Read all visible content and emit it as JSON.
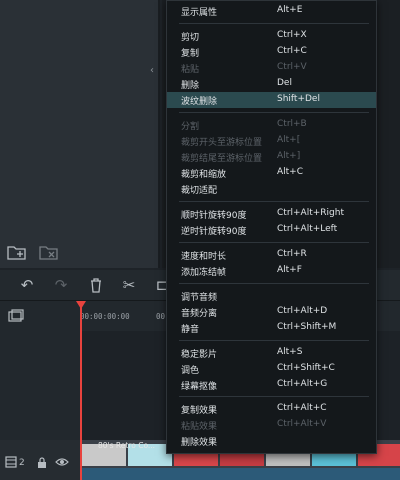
{
  "colors": {
    "accent_playhead": "#e8433e",
    "menu_highlight": "#2b4a4f",
    "menu_bg": "#14181b"
  },
  "ruler": {
    "time_start": "00:00:00:00",
    "time_next": "00"
  },
  "track": {
    "count": "2"
  },
  "clip": {
    "name": "80's Retro Co..."
  },
  "context_menu": {
    "items": [
      {
        "label": "显示属性",
        "shortcut": "Alt+E",
        "disabled": false
      },
      {
        "label": "剪切",
        "shortcut": "Ctrl+X",
        "disabled": false
      },
      {
        "label": "复制",
        "shortcut": "Ctrl+C",
        "disabled": false
      },
      {
        "label": "粘贴",
        "shortcut": "Ctrl+V",
        "disabled": true
      },
      {
        "label": "删除",
        "shortcut": "Del",
        "disabled": false
      },
      {
        "label": "波纹删除",
        "shortcut": "Shift+Del",
        "disabled": false,
        "highlighted": true
      },
      {
        "label": "分割",
        "shortcut": "Ctrl+B",
        "disabled": true
      },
      {
        "label": "裁剪开头至游标位置",
        "shortcut": "Alt+[",
        "disabled": true
      },
      {
        "label": "裁剪结尾至游标位置",
        "shortcut": "Alt+]",
        "disabled": true
      },
      {
        "label": "裁剪和缩放",
        "shortcut": "Alt+C",
        "disabled": false
      },
      {
        "label": "裁切适配",
        "shortcut": "",
        "disabled": false
      },
      {
        "label": "顺时针旋转90度",
        "shortcut": "Ctrl+Alt+Right",
        "disabled": false
      },
      {
        "label": "逆时针旋转90度",
        "shortcut": "Ctrl+Alt+Left",
        "disabled": false
      },
      {
        "label": "速度和时长",
        "shortcut": "Ctrl+R",
        "disabled": false
      },
      {
        "label": "添加冻结帧",
        "shortcut": "Alt+F",
        "disabled": false
      },
      {
        "label": "调节音频",
        "shortcut": "",
        "disabled": false
      },
      {
        "label": "音频分离",
        "shortcut": "Ctrl+Alt+D",
        "disabled": false
      },
      {
        "label": "静音",
        "shortcut": "Ctrl+Shift+M",
        "disabled": false
      },
      {
        "label": "稳定影片",
        "shortcut": "Alt+S",
        "disabled": false
      },
      {
        "label": "调色",
        "shortcut": "Ctrl+Shift+C",
        "disabled": false
      },
      {
        "label": "绿幕抠像",
        "shortcut": "Ctrl+Alt+G",
        "disabled": false
      },
      {
        "label": "复制效果",
        "shortcut": "Ctrl+Alt+C",
        "disabled": false
      },
      {
        "label": "粘贴效果",
        "shortcut": "Ctrl+Alt+V",
        "disabled": true
      },
      {
        "label": "删除效果",
        "shortcut": "",
        "disabled": false
      }
    ]
  }
}
